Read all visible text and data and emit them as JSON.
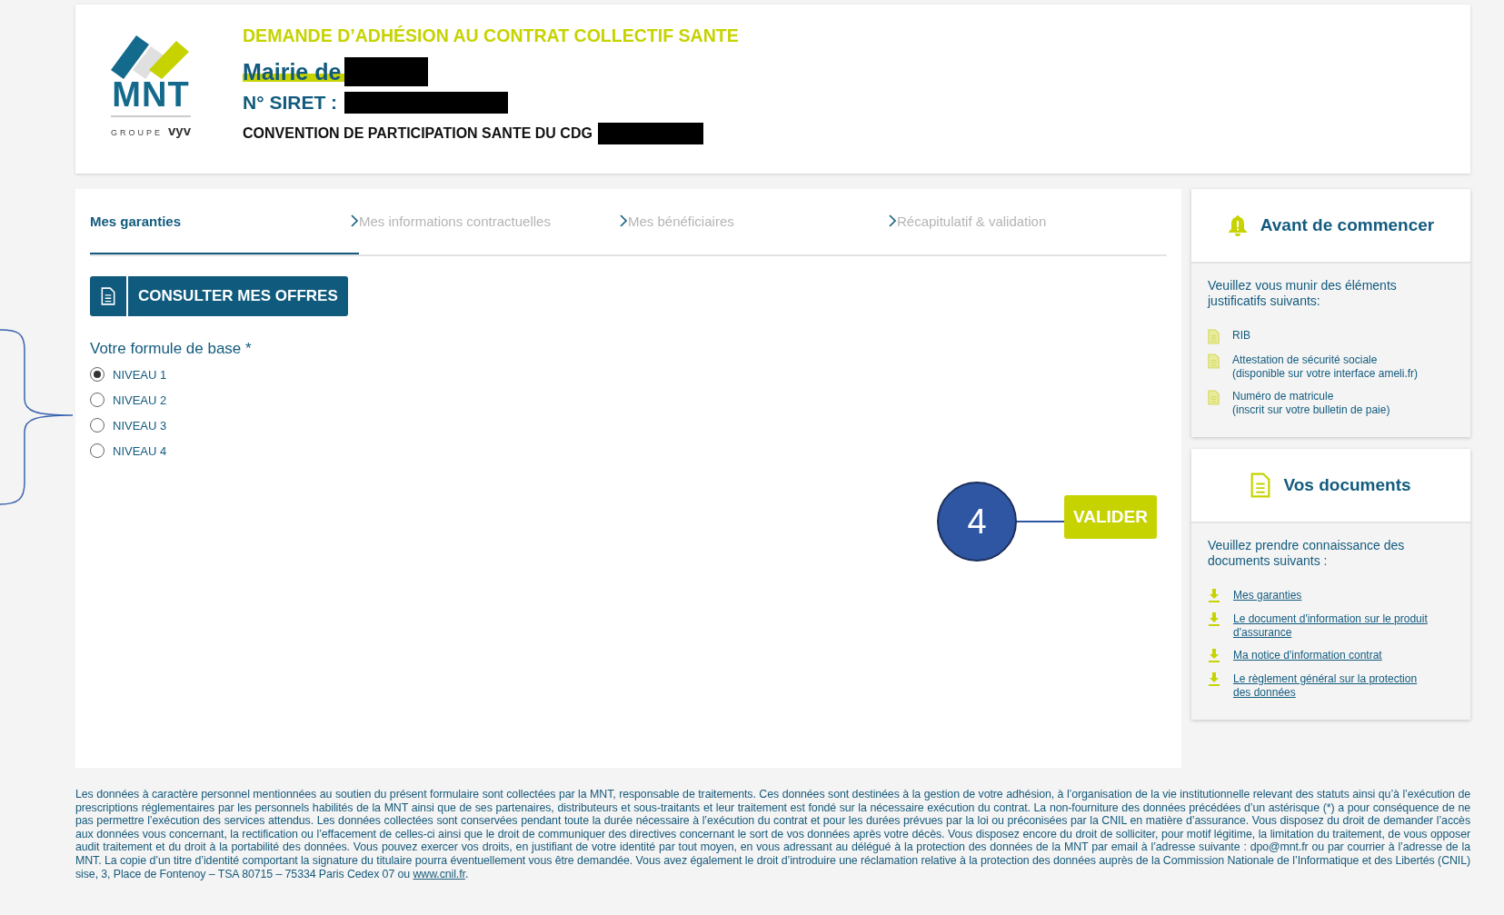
{
  "header": {
    "logo": {
      "name": "MNT",
      "group": "GROUPE",
      "brand": "vyv"
    },
    "title": "DEMANDE D’ADHÉSION AU CONTRAT COLLECTIF SANTE",
    "employer_label": "Mairie de",
    "siret_label": "N° SIRET :",
    "convention": "CONVENTION DE PARTICIPATION SANTE DU CDG"
  },
  "steps": [
    {
      "label": "Mes garanties",
      "selected": true
    },
    {
      "label": "Mes informations contractuelles",
      "selected": false
    },
    {
      "label": "Mes bénéficiaires",
      "selected": false
    },
    {
      "label": "Récapitulatif & validation",
      "selected": false
    }
  ],
  "offers_button": "CONSULTER MES OFFRES",
  "formula": {
    "label": "Votre formule de base *",
    "options": [
      {
        "label": "NIVEAU 1",
        "selected": true
      },
      {
        "label": "NIVEAU 2",
        "selected": false
      },
      {
        "label": "NIVEAU 3",
        "selected": false
      },
      {
        "label": "NIVEAU 4",
        "selected": false
      }
    ]
  },
  "validate_button": "VALIDER",
  "annotation": {
    "marker": "4"
  },
  "before_start": {
    "title": "Avant de commencer",
    "intro": "Veuillez vous munir des éléments justificatifs suivants:",
    "items": [
      {
        "title": "RIB"
      },
      {
        "title": "Attestation de sécurité sociale",
        "detail": "(disponible sur votre interface ameli.fr)"
      },
      {
        "title": "Numéro de matricule",
        "detail": "(inscrit sur votre bulletin de paie)"
      }
    ]
  },
  "documents": {
    "title": "Vos documents",
    "intro": "Veuillez prendre connaissance des documents suivants :",
    "links": [
      "Mes garanties",
      "Le document d'information sur le produit d'assurance",
      "Ma notice d'information contrat",
      "Le règlement général sur la protection des données"
    ]
  },
  "footer": {
    "text": "Les données à caractère personnel mentionnées au soutien du présent formulaire sont collectées par la MNT, responsable de traitements. Ces données sont destinées à la gestion de votre adhésion, à l’organisation de la vie institutionnelle relevant des statuts ainsi qu’à l’exécution de prescriptions réglementaires par les personnels habilités de la MNT ainsi que de ses partenaires, distributeurs et sous-traitants et leur traitement est fondé sur la nécessaire exécution du contrat. La non-fourniture des données précédées d’un astérisque (*) a pour conséquence de ne pas permettre l’exécution des services attendus. Les données collectées sont conservées pendant toute la durée nécessaire à l’exécution du contrat et pour les durées prévues par la loi ou préconisées par la CNIL en matière d’assurance. Vous disposez du droit de demander l’accès aux données vous concernant, la rectification ou l’effacement de celles-ci ainsi que le droit de communiquer des directives concernant le sort de vos données après votre décès. Vous disposez encore du droit de solliciter, pour motif légitime, la limitation du traitement, de vous opposer audit traitement et du droit à la portabilité des données. Vous pouvez exercer vos droits, en justifiant de votre identité par tout moyen, en vous adressant au délégué à la protection des données de la MNT par email à l’adresse suivante : dpo@mnt.fr ou par courrier à l’adresse de la MNT. La copie d’un titre d’identité comportant la signature du titulaire pourra éventuellement vous être demandée. Vous avez également le droit d’introduire une réclamation relative à la protection des données auprès de la Commission Nationale de l’Informatique et des Libertés (CNIL) sise, 3, Place de Fontenoy – TSA 80715 – 75334 Paris Cedex 07 ou",
    "link": "www.cnil.fr",
    "end": "."
  }
}
